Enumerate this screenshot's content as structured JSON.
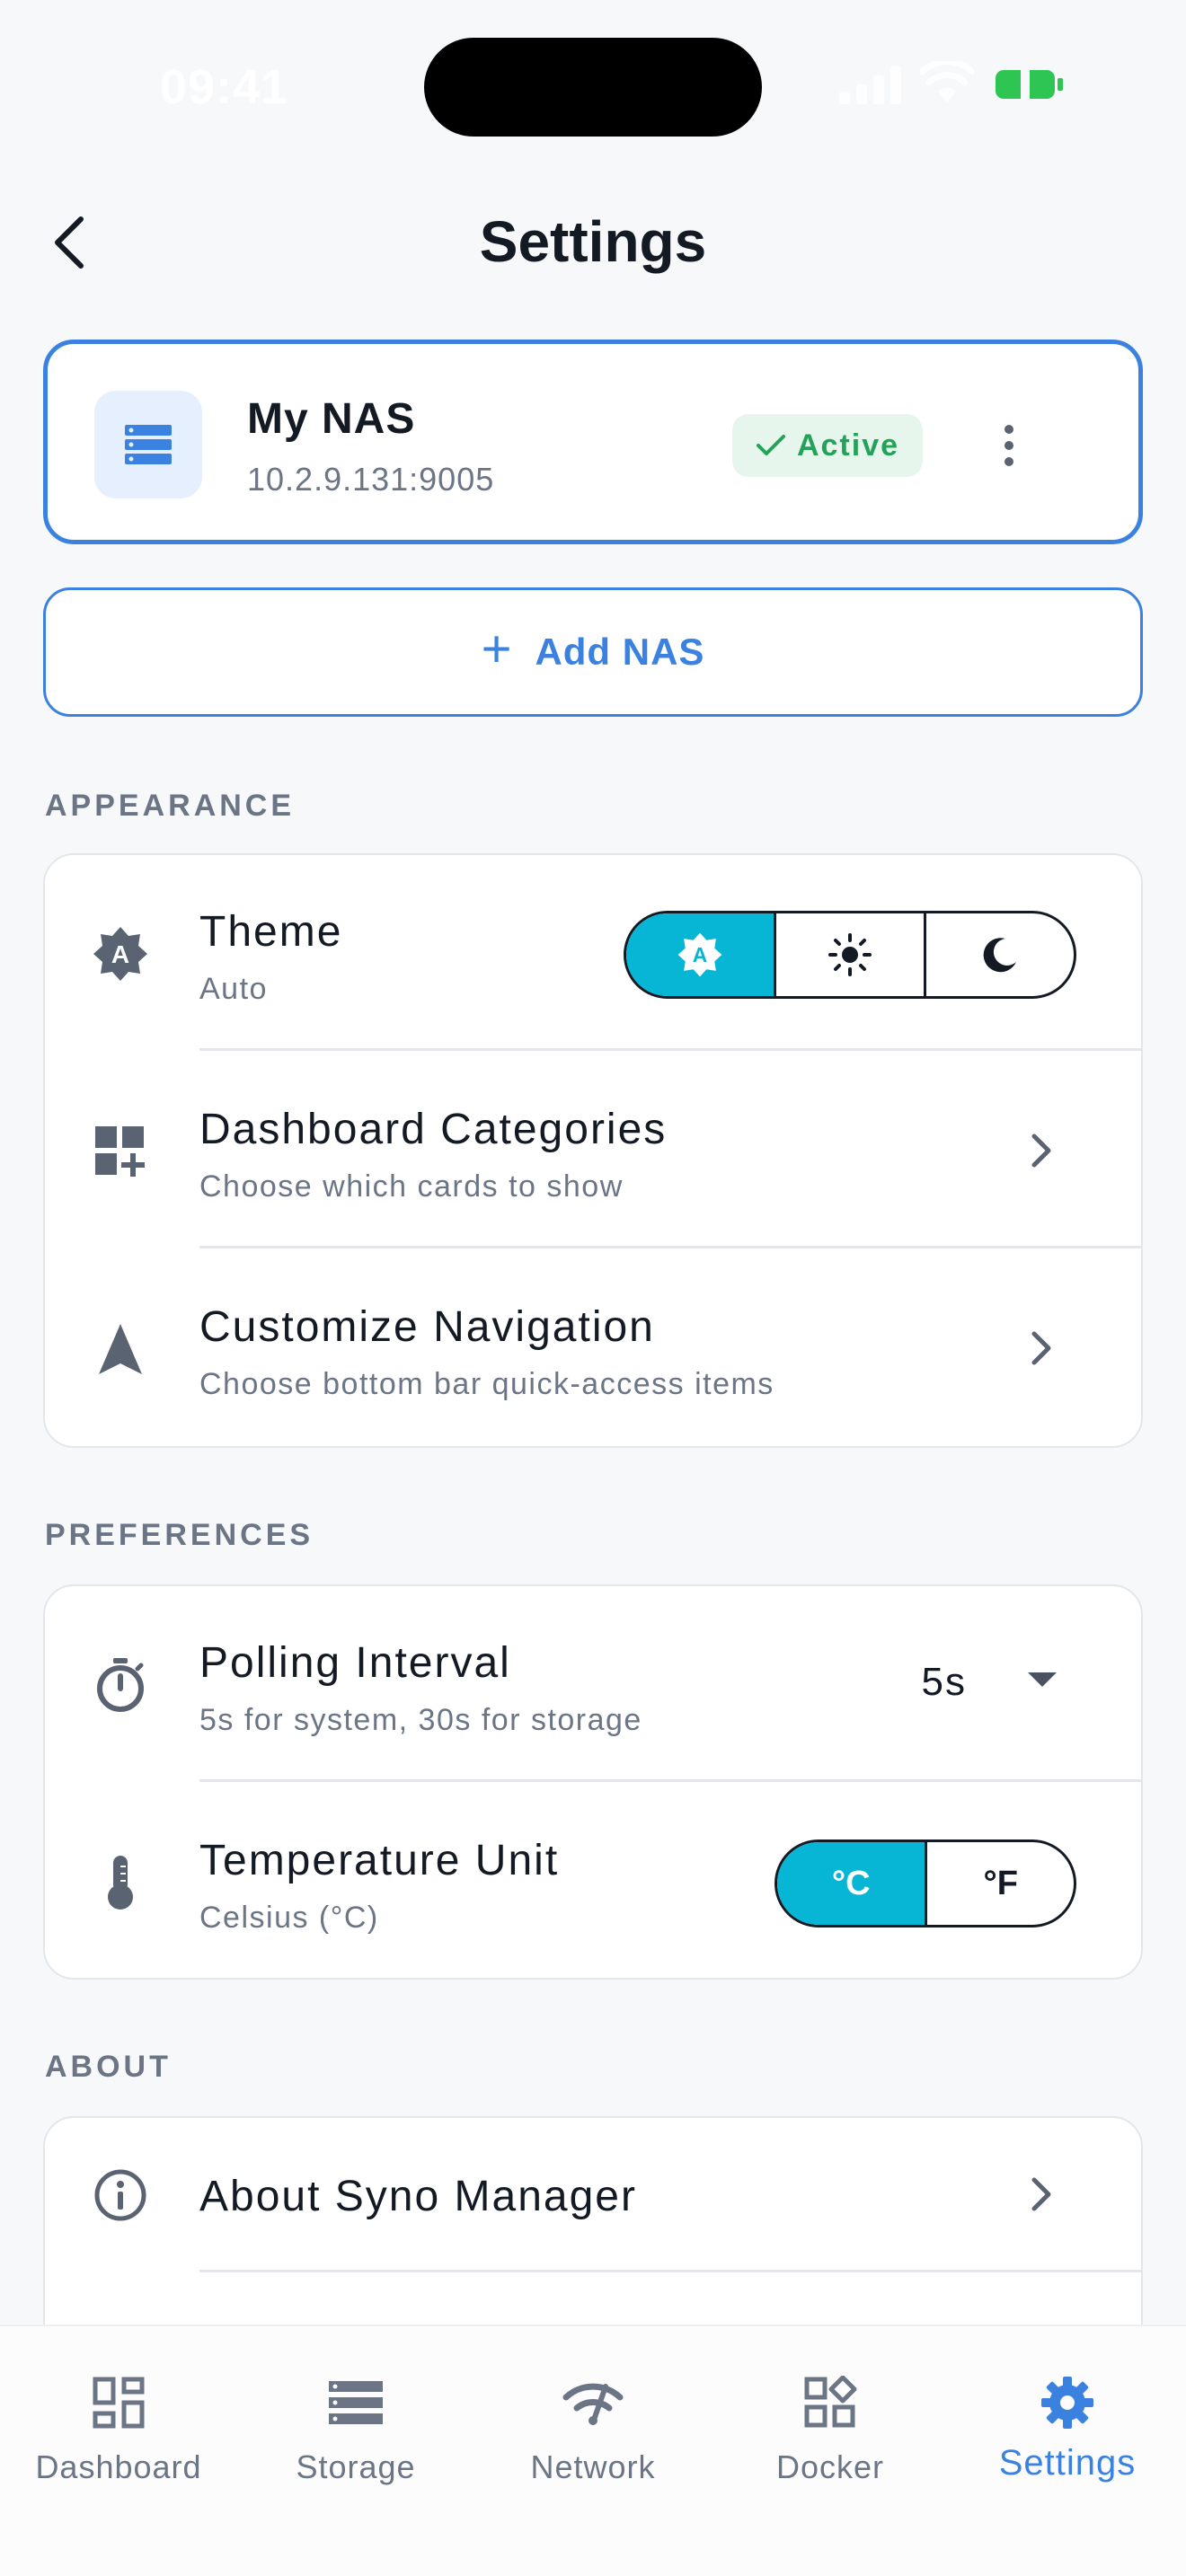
{
  "status_bar": {
    "time": "09:41"
  },
  "header": {
    "title": "Settings"
  },
  "nas": {
    "name": "My NAS",
    "address": "10.2.9.131:9005",
    "status": "Active"
  },
  "add_nas": {
    "label": "Add NAS"
  },
  "sections": {
    "appearance": {
      "header": "APPEARANCE",
      "theme": {
        "title": "Theme",
        "subtitle": "Auto",
        "options": [
          "auto",
          "light",
          "dark"
        ],
        "selected": "auto"
      },
      "dashboard_categories": {
        "title": "Dashboard Categories",
        "subtitle": "Choose which cards to show"
      },
      "customize_navigation": {
        "title": "Customize Navigation",
        "subtitle": "Choose bottom bar quick-access items"
      }
    },
    "preferences": {
      "header": "PREFERENCES",
      "polling": {
        "title": "Polling Interval",
        "subtitle": "5s for system, 30s for storage",
        "value": "5s"
      },
      "temperature": {
        "title": "Temperature Unit",
        "subtitle": "Celsius (°C)",
        "options": [
          "°C",
          "°F"
        ],
        "selected": "°C"
      }
    },
    "about": {
      "header": "ABOUT",
      "about_app": {
        "title": "About Syno Manager"
      }
    }
  },
  "bottom_nav": {
    "items": [
      {
        "label": "Dashboard",
        "icon": "dashboard-icon"
      },
      {
        "label": "Storage",
        "icon": "storage-icon"
      },
      {
        "label": "Network",
        "icon": "network-icon"
      },
      {
        "label": "Docker",
        "icon": "docker-icon"
      },
      {
        "label": "Settings",
        "icon": "gear-icon",
        "active": true
      }
    ]
  },
  "colors": {
    "accent": "#3b82e0",
    "segment_selected": "#06b6d4",
    "active_green": "#24a25a",
    "background": "#f7f8fa"
  }
}
